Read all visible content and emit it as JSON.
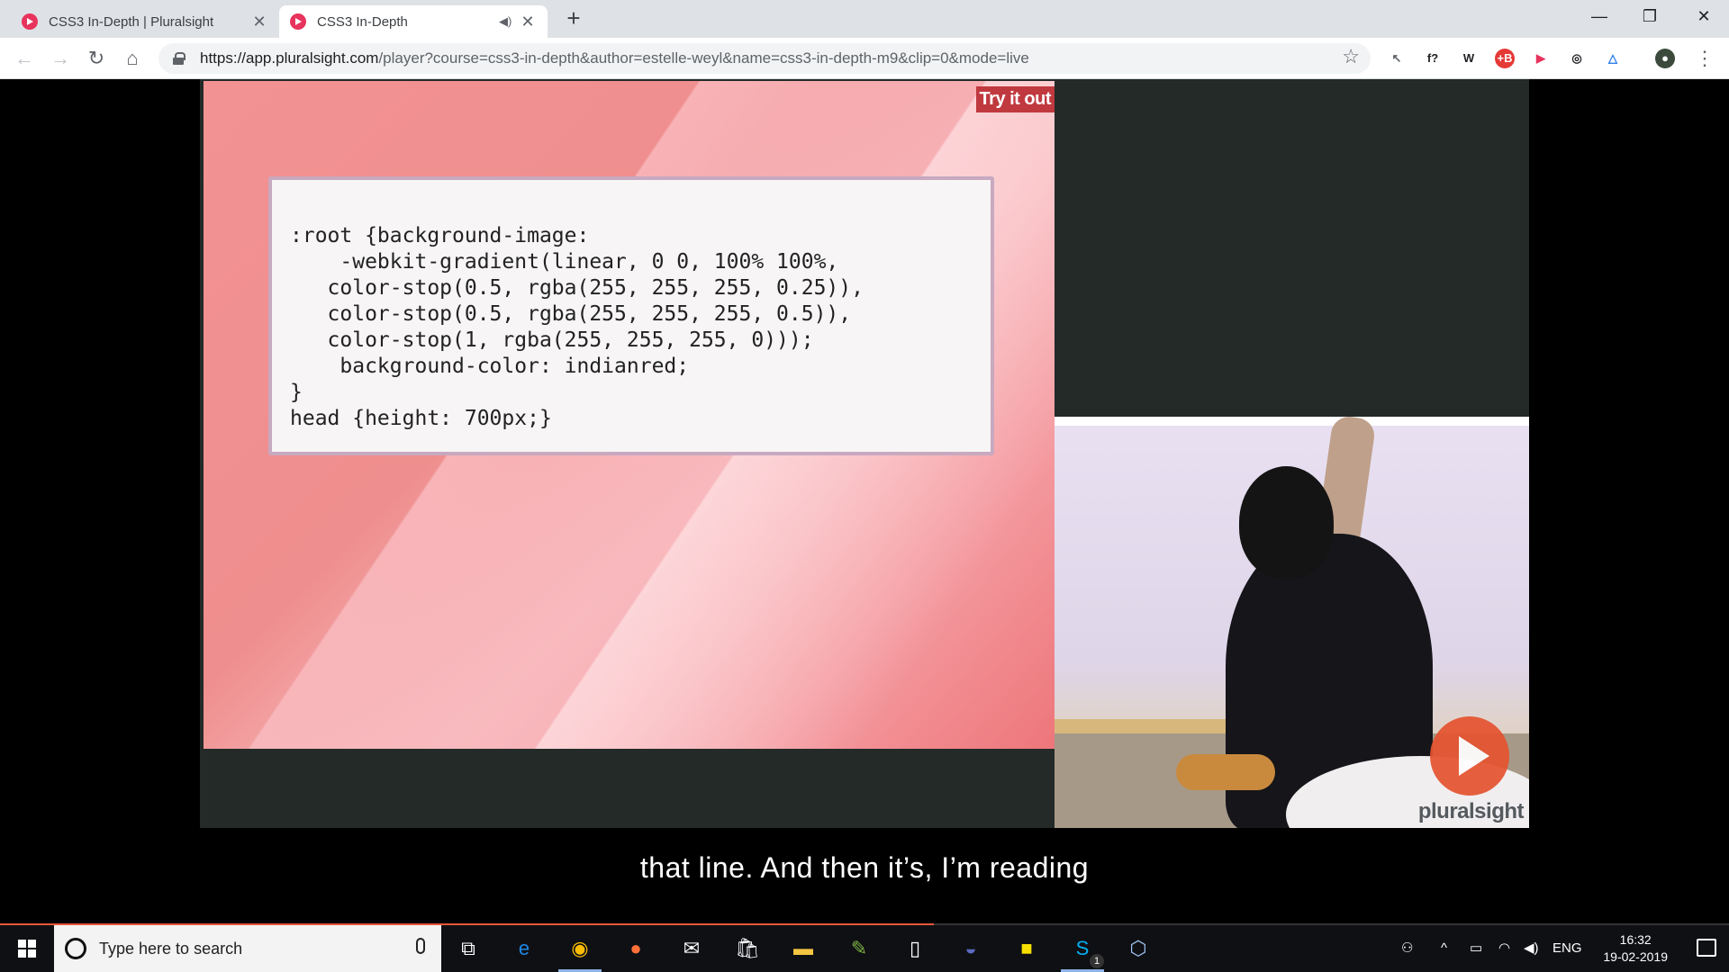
{
  "browser": {
    "tabs": [
      {
        "title": "CSS3 In-Depth | Pluralsight",
        "active": false,
        "audio": false
      },
      {
        "title": "CSS3 In-Depth",
        "active": true,
        "audio": true
      }
    ],
    "new_tab": "+",
    "window_controls": {
      "minimize": "—",
      "restore": "❐",
      "close": "✕"
    },
    "nav": {
      "back": "←",
      "forward": "→",
      "reload": "↻",
      "home": "⌂"
    },
    "url": {
      "host": "https://app.pluralsight.com",
      "path": "/player?course=css3-in-depth&author=estelle-weyl&name=css3-in-depth-m9&clip=0&mode=live"
    },
    "bookmark_icon": "☆",
    "extensions": [
      {
        "name": "cursor-extension-icon",
        "glyph": "↖",
        "bg": "#ffffff",
        "fg": "#5f6368"
      },
      {
        "name": "font-extension-icon",
        "glyph": "f?",
        "bg": "#ffffff",
        "fg": "#202124"
      },
      {
        "name": "wordpress-extension-icon",
        "glyph": "W",
        "bg": "#ffffff",
        "fg": "#202124"
      },
      {
        "name": "adblock-extension-icon",
        "glyph": "+B",
        "bg": "#e53935",
        "fg": "#ffffff"
      },
      {
        "name": "cast-extension-icon",
        "glyph": "▶",
        "bg": "#ffffff",
        "fg": "#e8335d"
      },
      {
        "name": "sync-extension-icon",
        "glyph": "◎",
        "bg": "#ffffff",
        "fg": "#202124"
      },
      {
        "name": "drive-extension-icon",
        "glyph": "△",
        "bg": "#ffffff",
        "fg": "#1a73e8"
      }
    ],
    "menu_icon": "⋮"
  },
  "player": {
    "slide": {
      "badge": "Try it out",
      "code_lines": [
        ":root {background-image:",
        "    -webkit-gradient(linear, 0 0, 100% 100%,",
        "   color-stop(0.5, rgba(255, 255, 255, 0.25)),",
        "   color-stop(0.5, rgba(255, 255, 255, 0.5)),",
        "   color-stop(1, rgba(255, 255, 255, 0)));",
        "    background-color: indianred;",
        "}",
        "head {height: 700px;}"
      ]
    },
    "logo_text": "pluralsight",
    "caption": "that line. And then it’s, I’m reading",
    "progress_percent": 54,
    "colors": {
      "accent": "#e9563a",
      "slide_bg": "#ef8e8e",
      "badge_bg": "#c0393f"
    }
  },
  "taskbar": {
    "search_placeholder": "Type here to search",
    "apps": [
      {
        "name": "task-view-icon",
        "glyph": "⧉",
        "color": "#ffffff",
        "active": false
      },
      {
        "name": "edge-icon",
        "glyph": "e",
        "color": "#1e88e5",
        "active": false
      },
      {
        "name": "chrome-icon",
        "glyph": "◉",
        "color": "#fbbc04",
        "active": true
      },
      {
        "name": "firefox-icon",
        "glyph": "●",
        "color": "#ff7139",
        "active": false
      },
      {
        "name": "mail-icon",
        "glyph": "✉",
        "color": "#ffffff",
        "active": false
      },
      {
        "name": "store-icon",
        "glyph": "🛍",
        "color": "#ffffff",
        "active": false
      },
      {
        "name": "file-explorer-icon",
        "glyph": "▬",
        "color": "#f4c542",
        "active": false
      },
      {
        "name": "notepadpp-icon",
        "glyph": "✎",
        "color": "#7cb342",
        "active": false
      },
      {
        "name": "document-icon",
        "glyph": "▯",
        "color": "#ffffff",
        "active": false
      },
      {
        "name": "eclipse-icon",
        "glyph": "◒",
        "color": "#5c6bc0",
        "active": false
      },
      {
        "name": "sticky-notes-icon",
        "glyph": "■",
        "color": "#f7e000",
        "active": false
      },
      {
        "name": "skype-icon",
        "glyph": "S",
        "color": "#00aff0",
        "active": true
      },
      {
        "name": "virtualbox-icon",
        "glyph": "⬡",
        "color": "#9ec3f0",
        "active": false
      }
    ],
    "skype_badge": "1",
    "tray": {
      "language": "ENG",
      "time": "16:32",
      "date": "19-02-2019"
    }
  }
}
